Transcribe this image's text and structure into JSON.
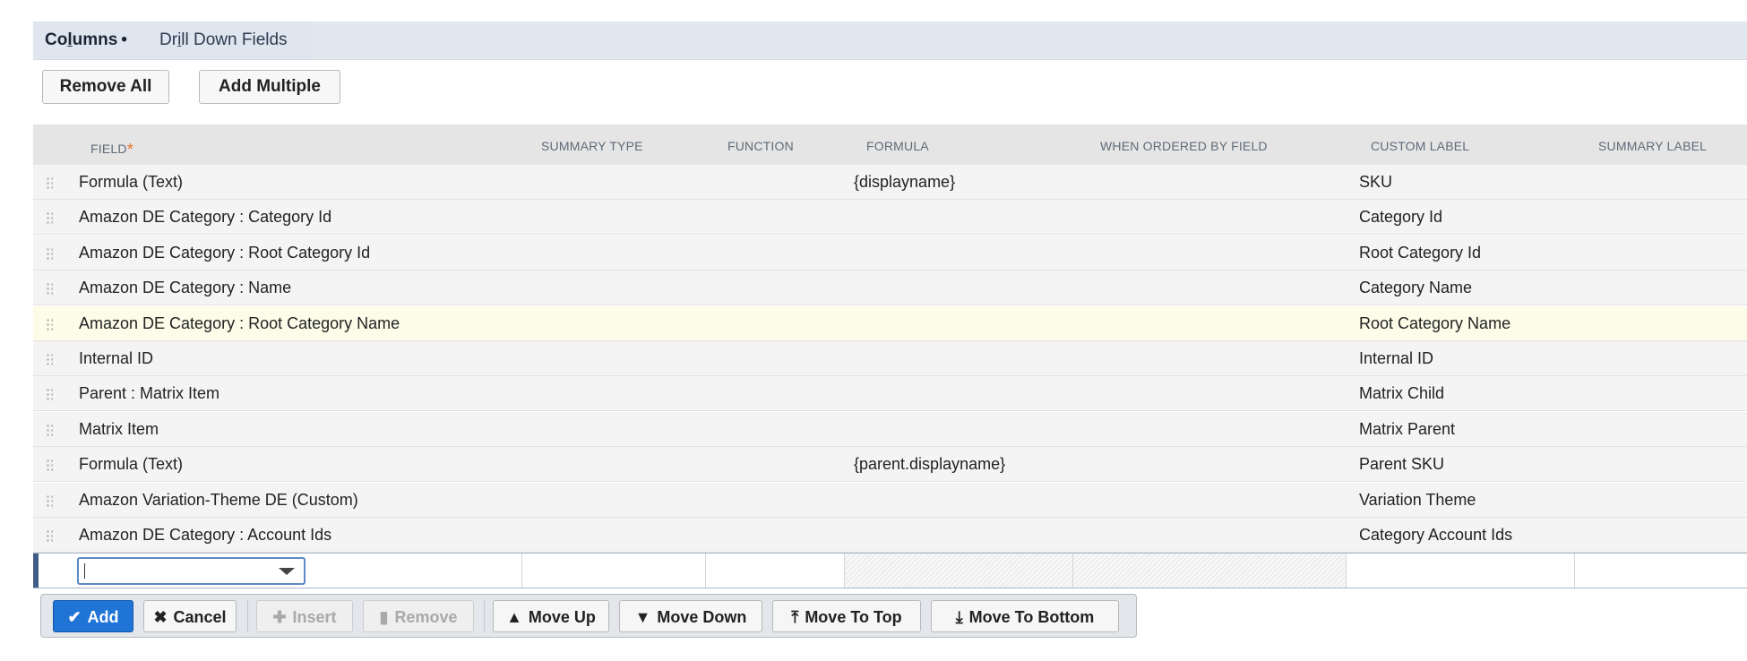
{
  "tabs": {
    "columns": {
      "pre": "Co",
      "ul": "l",
      "post": "umns",
      "dot": "•"
    },
    "drill": {
      "pre": "Dr",
      "ul": "i",
      "post": "ll Down Fields"
    }
  },
  "buttons": {
    "remove_all": "Remove All",
    "add_multiple": "Add Multiple"
  },
  "table": {
    "headers": {
      "field": "FIELD",
      "field_required": "*",
      "summary_type": "SUMMARY TYPE",
      "function": "FUNCTION",
      "formula": "FORMULA",
      "when_ordered_by_field": "WHEN ORDERED BY FIELD",
      "custom_label": "CUSTOM LABEL",
      "summary_label": "SUMMARY LABEL"
    },
    "rows": [
      {
        "field": "Formula (Text)",
        "formula": "{displayname}",
        "custom_label": "SKU"
      },
      {
        "field": "Amazon DE Category : Category Id",
        "formula": "",
        "custom_label": "Category Id"
      },
      {
        "field": "Amazon DE Category : Root Category Id",
        "formula": "",
        "custom_label": "Root Category Id"
      },
      {
        "field": "Amazon DE Category : Name",
        "formula": "",
        "custom_label": "Category Name"
      },
      {
        "field": "Amazon DE Category : Root Category Name",
        "formula": "",
        "custom_label": "Root Category Name"
      },
      {
        "field": "Internal ID",
        "formula": "",
        "custom_label": "Internal ID"
      },
      {
        "field": "Parent : Matrix Item",
        "formula": "",
        "custom_label": "Matrix Child"
      },
      {
        "field": "Matrix Item",
        "formula": "",
        "custom_label": "Matrix Parent"
      },
      {
        "field": "Formula (Text)",
        "formula": "{parent.displayname}",
        "custom_label": "Parent SKU"
      },
      {
        "field": "Amazon Variation-Theme DE (Custom)",
        "formula": "",
        "custom_label": "Variation Theme"
      },
      {
        "field": "Amazon DE Category : Account Ids",
        "formula": "",
        "custom_label": "Category Account Ids"
      }
    ],
    "highlighted_row": 4
  },
  "edit_row": {
    "field_value": ""
  },
  "toolbar": {
    "add": "Add",
    "cancel": "Cancel",
    "insert": "Insert",
    "remove": "Remove",
    "move_up": "Move Up",
    "move_down": "Move Down",
    "move_to_top": "Move To Top",
    "move_to_bottom": "Move To Bottom"
  },
  "icons": {
    "add": "check-icon",
    "cancel": "x-icon",
    "insert": "plus-icon",
    "remove": "trash-icon",
    "move_up": "arrow-up-icon",
    "move_down": "arrow-down-icon",
    "move_to_top": "arrow-top-icon",
    "move_to_bottom": "arrow-bottom-icon"
  },
  "colors": {
    "primary": "#1f74d6",
    "required": "#e8752b",
    "highlight_row": "#fcfce9"
  }
}
